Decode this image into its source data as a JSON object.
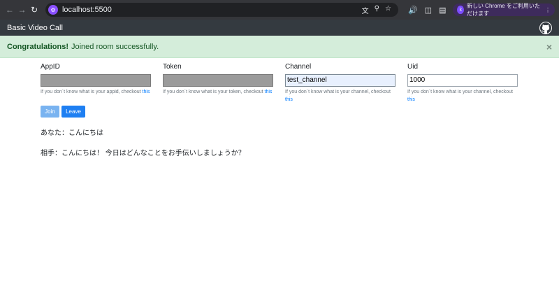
{
  "browser": {
    "url": "localhost:5500",
    "update_prompt": "新しい Chrome をご利用いただけます",
    "profile_initial": "k"
  },
  "navbar": {
    "brand": "Basic Video Call"
  },
  "alert": {
    "strong": "Congratulations!",
    "message": "Joined room successfully.",
    "close": "×"
  },
  "form": {
    "appid": {
      "label": "AppID",
      "value": "",
      "help_text": "If you don`t know what is your appid, checkout",
      "help_link": "this"
    },
    "token": {
      "label": "Token",
      "value": "",
      "help_text": "If you don`t know what is your token, checkout",
      "help_link": "this"
    },
    "channel": {
      "label": "Channel",
      "value": "test_channel",
      "help_text": "If you don`t know what is your channel, checkout",
      "help_link": "this"
    },
    "uid": {
      "label": "Uid",
      "value": "1000",
      "help_text": "If you don`t know what is your channel, checkout",
      "help_link": "this"
    },
    "join_label": "Join",
    "leave_label": "Leave"
  },
  "messages": [
    "あなた：こんにちは",
    "相手：こんにちは！ 今日はどんなことをお手伝いしましょうか？"
  ]
}
